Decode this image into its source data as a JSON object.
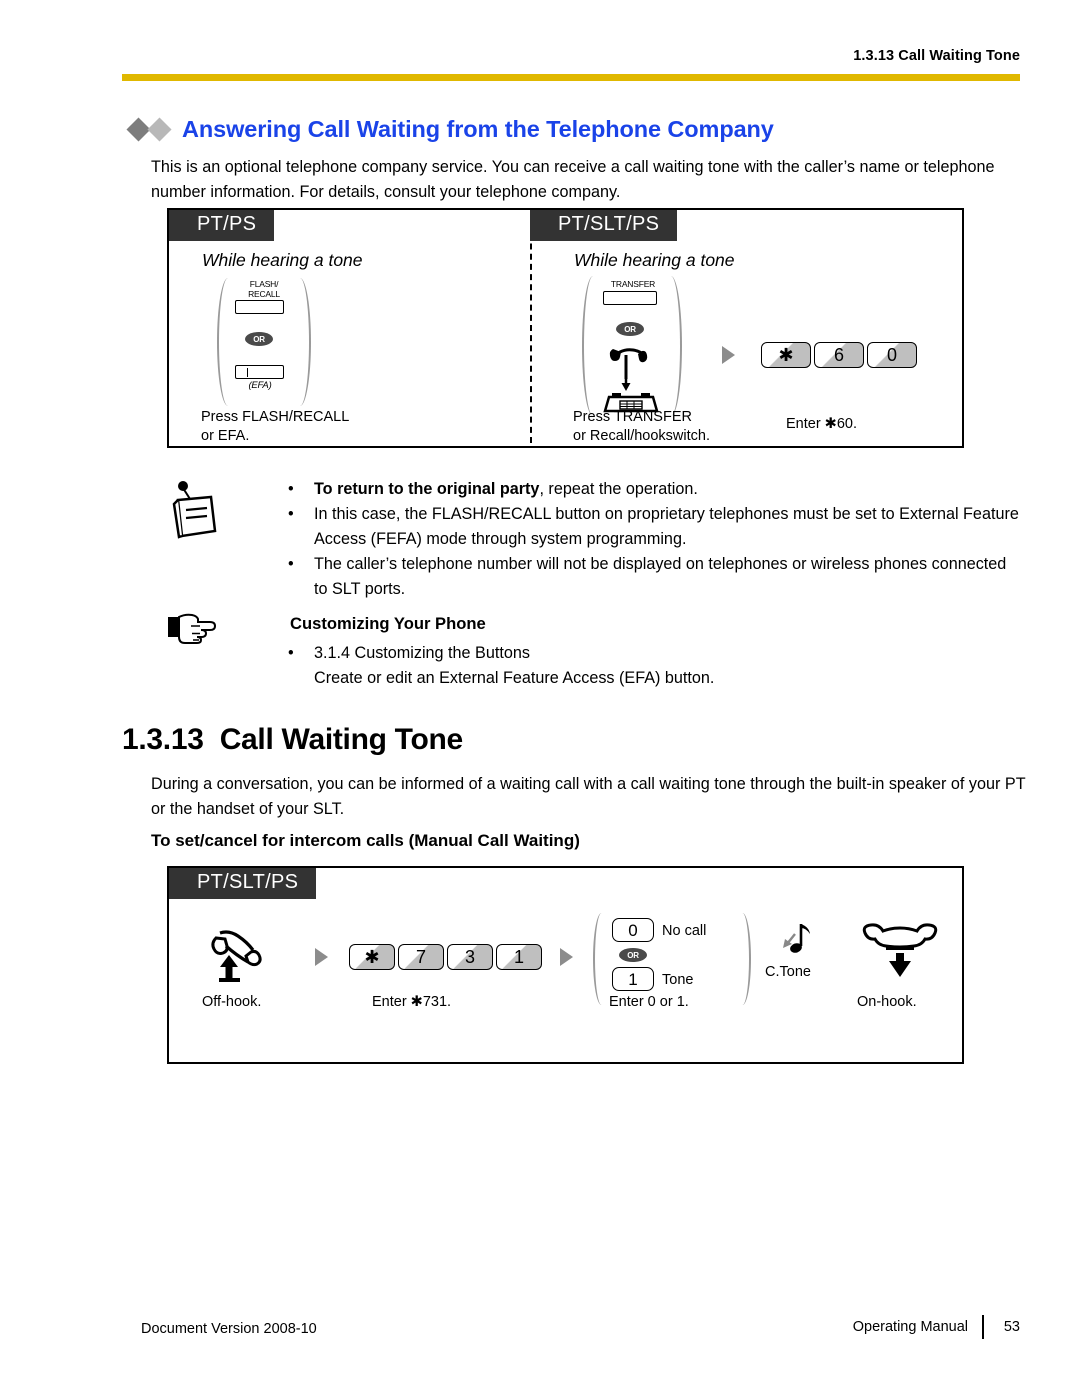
{
  "header": {
    "running_head": "1.3.13 Call Waiting Tone",
    "rule_color": "#E0B800"
  },
  "topic": {
    "title": "Answering Call Waiting from the Telephone Company",
    "title_color": "#1a43e8",
    "intro": "This is an optional telephone company service. You can receive a call waiting tone with the caller’s name or telephone number information. For details, consult your telephone company."
  },
  "diagram1": {
    "left_panel": {
      "tag": "PT/PS",
      "condition": "While hearing a tone",
      "button_label": "FLASH/\nRECALL",
      "button_label_line1": "FLASH/",
      "button_label_line2": "RECALL",
      "or_label": "OR",
      "efa_label": "(EFA)",
      "caption_line1": "Press FLASH/RECALL",
      "caption_line2": "or EFA."
    },
    "right_panel": {
      "tag": "PT/SLT/PS",
      "condition": "While hearing a tone",
      "button_label": "TRANSFER",
      "or_label": "OR",
      "hookswitch_icon": "hookswitch-icon",
      "caption_line1": "Press TRANSFER",
      "caption_line2": "or Recall/hookswitch.",
      "keys": [
        "✱",
        "6",
        "0"
      ],
      "keys_caption": "Enter ✱60."
    }
  },
  "notes": {
    "icon": "note-memo-icon",
    "items": [
      {
        "bold": "To return to the original party",
        "rest": ", repeat the operation."
      },
      {
        "bold": "",
        "rest": "In this case, the FLASH/RECALL button on proprietary telephones must be set to External Feature Access (FEFA) mode through system programming."
      },
      {
        "bold": "",
        "rest": "The caller’s telephone number will not be displayed on telephones or wireless phones connected to SLT ports."
      }
    ]
  },
  "customizing": {
    "icon": "pointing-hand-icon",
    "title": "Customizing Your Phone",
    "bullet": "3.1.4  Customizing the Buttons",
    "bullet_sub": "Create or edit an External Feature Access (EFA) button."
  },
  "section": {
    "number": "1.3.13",
    "title": "Call Waiting Tone",
    "body": "During a conversation, you can be informed of a waiting call with a call waiting tone through the built-in speaker of your PT or the handset of your SLT.",
    "subheading": "To set/cancel for intercom calls (Manual Call Waiting)"
  },
  "diagram2": {
    "tag": "PT/SLT/PS",
    "steps": [
      {
        "icon": "offhook-handset-icon",
        "caption": "Off-hook."
      },
      {
        "keys": [
          "✱",
          "7",
          "3",
          "1"
        ],
        "caption": "Enter  ✱731."
      },
      {
        "options": [
          {
            "key": "0",
            "label": "No call"
          },
          {
            "key": "1",
            "label": "Tone"
          }
        ],
        "or_label": "OR",
        "caption": "Enter 0 or 1."
      },
      {
        "icon": "confirmation-tone-icon",
        "label": "C.Tone"
      },
      {
        "icon": "onhook-handset-icon",
        "caption": "On-hook."
      }
    ]
  },
  "footer": {
    "left": "Document Version  2008-10",
    "manual": "Operating Manual",
    "page": "53"
  }
}
